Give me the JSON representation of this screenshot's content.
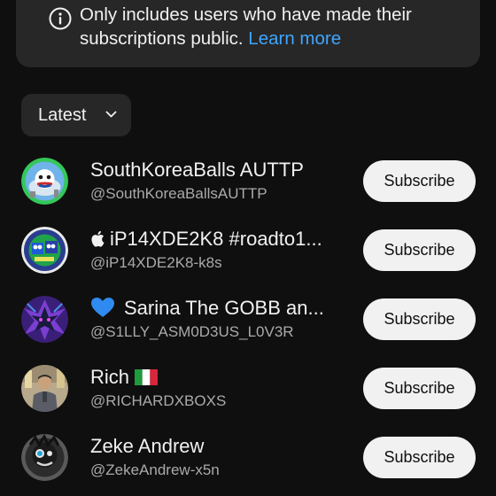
{
  "notice": {
    "text": "Only includes users who have made their subscriptions public.",
    "link": "Learn more",
    "icon": "info-icon"
  },
  "sort": {
    "label": "Latest",
    "icon": "chevron-down-icon"
  },
  "users": [
    {
      "name": "SouthKoreaBalls AUTTP",
      "handle": "@SouthKoreaBallsAUTTP",
      "button": "Subscribe"
    },
    {
      "name": "iP14XDE2K8 #roadto1...",
      "handle": "@iP14XDE2K8-k8s",
      "button": "Subscribe",
      "prefix_icon": "apple-icon"
    },
    {
      "name": "Sarina The GOBB an...",
      "handle": "@S1LLY_ASM0D3US_L0V3R",
      "button": "Subscribe",
      "prefix_icon": "blue-heart-icon"
    },
    {
      "name": "Rich",
      "handle": "@RICHARDXBOXS",
      "button": "Subscribe",
      "suffix_icon": "italy-flag-icon"
    },
    {
      "name": "Zeke Andrew",
      "handle": "@ZekeAndrew-x5n",
      "button": "Subscribe"
    }
  ],
  "colors": {
    "background": "#0f0f0f",
    "card": "#272727",
    "link": "#3ea6ff",
    "secondary_text": "#aaaaaa",
    "button_bg": "#f1f1f1"
  }
}
